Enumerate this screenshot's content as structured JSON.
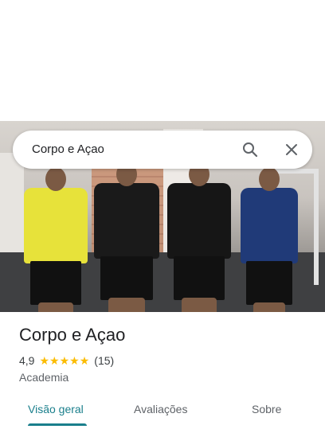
{
  "search": {
    "query": "Corpo e Açao"
  },
  "place": {
    "name": "Corpo e Açao",
    "rating": "4,9",
    "stars": 5,
    "review_count": "(15)",
    "category": "Academia"
  },
  "tabs": [
    {
      "label": "Visão geral",
      "active": true
    },
    {
      "label": "Avaliações",
      "active": false
    },
    {
      "label": "Sobre",
      "active": false
    }
  ],
  "colors": {
    "accent": "#1a7f8c",
    "star": "#fbbc04"
  }
}
